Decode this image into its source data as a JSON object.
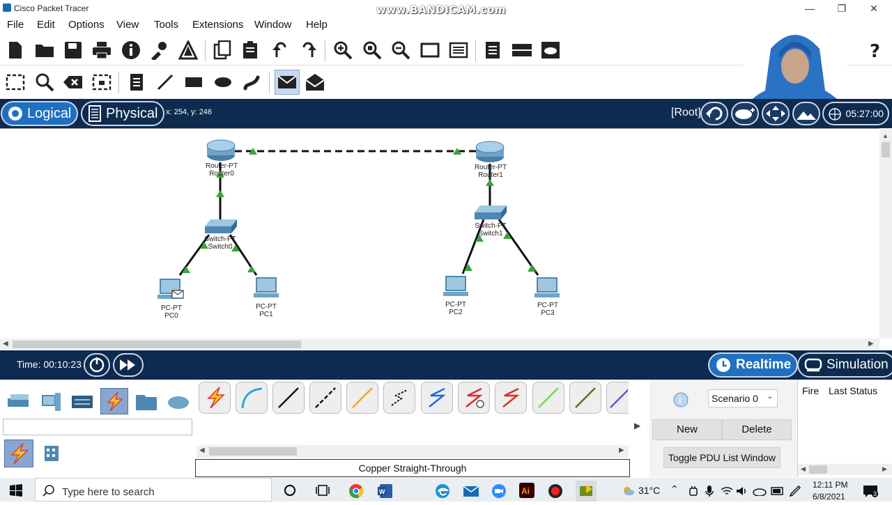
{
  "window": {
    "title": "Cisco Packet Tracer",
    "watermark": "www.BANDICAM.com"
  },
  "menu": [
    "File",
    "Edit",
    "Options",
    "View",
    "Tools",
    "Extensions",
    "Window",
    "Help"
  ],
  "modes": {
    "logical": "Logical",
    "physical": "Physical",
    "coords": "x: 254, y: 246",
    "root": "[Root]",
    "clock": "05:27:00"
  },
  "nodes": [
    {
      "type": "Router-PT",
      "name": "Router0"
    },
    {
      "type": "Router-PT",
      "name": "Router1"
    },
    {
      "type": "Switch-PT",
      "name": "Switch0"
    },
    {
      "type": "Switch-PT",
      "name": "Switch1"
    },
    {
      "type": "PC-PT",
      "name": "PC0"
    },
    {
      "type": "PC-PT",
      "name": "PC1"
    },
    {
      "type": "PC-PT",
      "name": "PC2"
    },
    {
      "type": "PC-PT",
      "name": "PC3"
    }
  ],
  "timebar": {
    "time": "Time: 00:10:23",
    "realtime": "Realtime",
    "simulation": "Simulation"
  },
  "connection_label": "Copper Straight-Through",
  "pdu": {
    "scenario": "Scenario 0",
    "new": "New",
    "delete": "Delete",
    "toggle": "Toggle PDU List Window"
  },
  "fire_panel": {
    "fire": "Fire",
    "last_status": "Last Status"
  },
  "taskbar": {
    "search": "Type here to search",
    "temp": "31°C",
    "time": "12:11 PM",
    "date": "6/8/2021",
    "notif": "3"
  }
}
